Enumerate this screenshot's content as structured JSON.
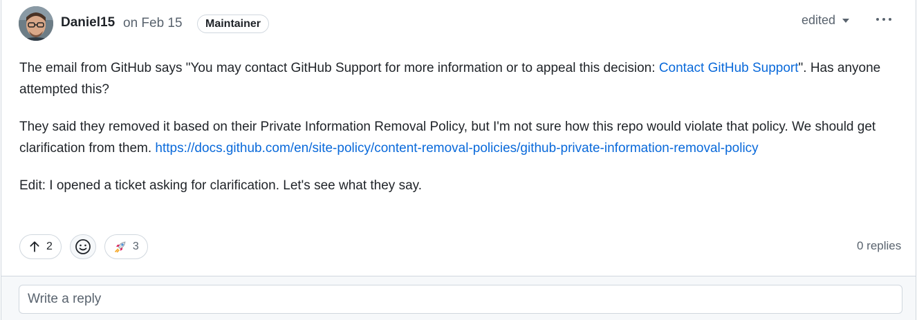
{
  "author": {
    "name": "Daniel15",
    "date": "on Feb 15",
    "badge": "Maintainer",
    "avatar_icon": "avatar-photo"
  },
  "header": {
    "edited_label": "edited",
    "more_icon": "kebab-horizontal-icon"
  },
  "body": {
    "p1_a": "The email from GitHub says \"You may contact GitHub Support for more information or to appeal this decision: ",
    "p1_link": "Contact GitHub Support",
    "p1_b": "\". Has anyone attempted this?",
    "p2_a": "They said they removed it based on their Private Information Removal Policy, but I'm not sure how this repo would violate that policy. We should get clarification from them. ",
    "p2_link": "https://docs.github.com/en/site-policy/content-removal-policies/github-private-information-removal-policy",
    "p3": "Edit: I opened a ticket asking for clarification. Let's see what they say."
  },
  "reactions": [
    {
      "icon": "arrow-up-icon",
      "count": "2"
    },
    {
      "icon": "smiley-icon",
      "count": ""
    },
    {
      "icon": "rocket-icon",
      "count": "3"
    }
  ],
  "replies_label": "0 replies",
  "reply": {
    "placeholder": "Write a reply"
  },
  "colors": {
    "link": "#0969da",
    "border": "#d0d7de",
    "muted": "#59636e"
  }
}
